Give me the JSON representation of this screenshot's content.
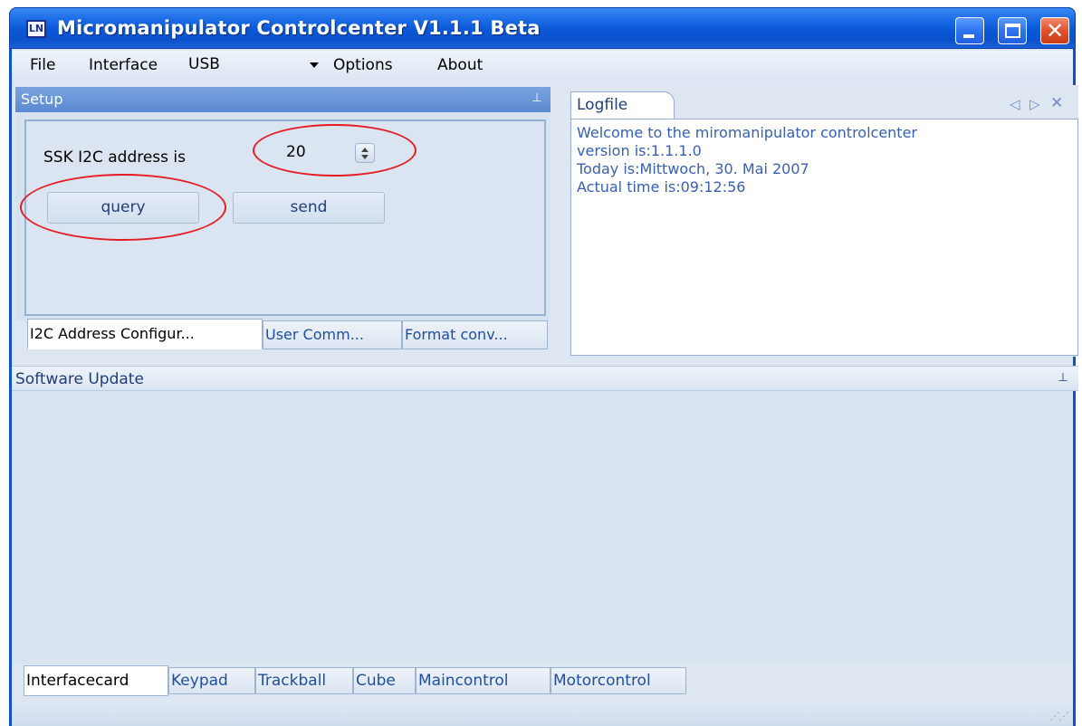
{
  "window": {
    "title": "Micromanipulator Controlcenter V1.1.1 Beta",
    "icon_text": "LN"
  },
  "menu": {
    "file": "File",
    "interface": "Interface",
    "interface_value": "USB",
    "options": "Options",
    "about": "About"
  },
  "setup": {
    "header": "Setup",
    "ssk_label": "SSK I2C address is",
    "address_value": "20",
    "query_button": "query",
    "send_button": "send",
    "tabs": [
      {
        "label": "I2C Address Configur...",
        "active": true
      },
      {
        "label": "User Comm...",
        "active": false
      },
      {
        "label": "Format conv...",
        "active": false
      }
    ]
  },
  "logfile": {
    "tab_label": "Logfile",
    "lines": [
      "Welcome to the miromanipulator controlcenter",
      "version is:1.1.1.0",
      "Today is:Mittwoch, 30. Mai 2007",
      "Actual time is:09:12:56"
    ]
  },
  "software_update": {
    "header": "Software Update"
  },
  "bottom_tabs": [
    {
      "label": "Interfacecard",
      "active": true
    },
    {
      "label": "Keypad",
      "active": false
    },
    {
      "label": "Trackball",
      "active": false
    },
    {
      "label": "Cube",
      "active": false
    },
    {
      "label": "Maincontrol",
      "active": false
    },
    {
      "label": "Motorcontrol",
      "active": false
    }
  ],
  "colors": {
    "titlebar": "#0b52cc",
    "panel_header": "#5b89d0",
    "annotation": "#e51c23",
    "log_text": "#3760b2"
  }
}
